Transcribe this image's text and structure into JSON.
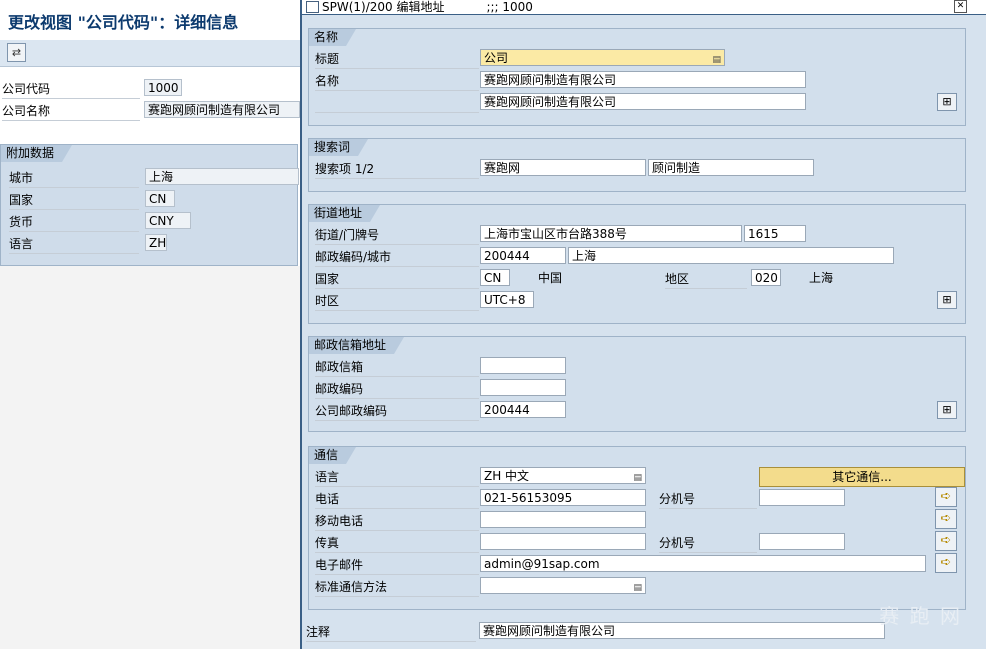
{
  "background": {
    "title": "更改视图 \"公司代码\"：详细信息",
    "company_code_label": "公司代码",
    "company_code_value": "1000",
    "company_name_label": "公司名称",
    "company_name_value": "赛跑网顾问制造有限公司",
    "additional_group_title": "附加数据",
    "city_label": "城市",
    "city_value": "上海",
    "country_label": "国家",
    "country_value": "CN",
    "currency_label": "货币",
    "currency_value": "CNY",
    "language_label": "语言",
    "language_value": "ZH"
  },
  "dialog": {
    "title": "SPW(1)/200 编辑地址",
    "title_suffix": ";;;  1000",
    "name_section": {
      "title": "名称",
      "salutation_label": "标题",
      "salutation_value": "公司",
      "name_label": "名称",
      "name1_value": "赛跑网顾问制造有限公司",
      "name2_value": "赛跑网顾问制造有限公司"
    },
    "search_section": {
      "title": "搜索词",
      "search_label": "搜索项 1/2",
      "search1_value": "赛跑网",
      "search2_value": "顾问制造"
    },
    "street_section": {
      "title": "街道地址",
      "street_label": "街道/门牌号",
      "street_value": "上海市宝山区市台路388号",
      "house_number_value": "1615",
      "postal_city_label": "邮政编码/城市",
      "postal_code_value": "200444",
      "city_value": "上海",
      "country_label": "国家",
      "country_value": "CN",
      "country_name": "中国",
      "region_label": "地区",
      "region_value": "020",
      "region_name": "上海",
      "timezone_label": "时区",
      "timezone_value": "UTC+8"
    },
    "pobox_section": {
      "title": "邮政信箱地址",
      "pobox_label": "邮政信箱",
      "pobox_value": "",
      "pobox_postal_label": "邮政编码",
      "pobox_postal_value": "",
      "company_postal_label": "公司邮政编码",
      "company_postal_value": "200444"
    },
    "comm_section": {
      "title": "通信",
      "language_label": "语言",
      "language_value": "ZH 中文",
      "other_comm_button": "其它通信...",
      "phone_label": "电话",
      "phone_value": "021-56153095",
      "ext_label": "分机号",
      "phone_ext_value": "",
      "mobile_label": "移动电话",
      "mobile_value": "",
      "fax_label": "传真",
      "fax_value": "",
      "fax_ext_label": "分机号",
      "fax_ext_value": "",
      "email_label": "电子邮件",
      "email_value": "admin@91sap.com",
      "std_comm_label": "标准通信方法",
      "std_comm_value": ""
    },
    "remark_label": "注释",
    "remark_value": "赛跑网顾问制造有限公司"
  },
  "watermark": "赛 跑 网"
}
